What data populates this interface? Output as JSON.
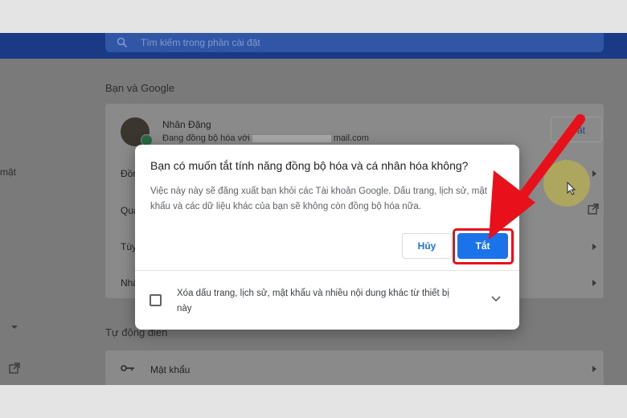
{
  "search": {
    "placeholder": "Tìm kiếm trong phần cài đặt",
    "icon": "search-icon"
  },
  "sidebar": {
    "partial_label": "mật"
  },
  "sections": {
    "you_and_google": {
      "title": "Bạn và Google",
      "user_name": "Nhân Đặng",
      "sync_status": "Đang đồng bộ hóa với",
      "email_suffix": "mail.com",
      "turn_off_label": "Tắt",
      "rows": [
        "Đồn",
        "Quả",
        "Tùy",
        "Nhậ"
      ]
    },
    "autofill": {
      "title": "Tự động điền",
      "password_label": "Mật khẩu"
    }
  },
  "dialog": {
    "title": "Bạn có muốn tắt tính năng đồng bộ hóa và cá nhân hóa không?",
    "body": "Việc này này sẽ đăng xuất bạn khỏi các Tài khoản Google. Dấu trang, lịch sử, mật khẩu và các dữ liệu khác của bạn sẽ không còn đồng bộ hóa nữa.",
    "cancel_label": "Hủy",
    "confirm_label": "Tắt",
    "checkbox_label": "Xóa dấu trang, lịch sử, mật khẩu và nhiều nội dung khác từ thiết bị này",
    "checkbox_checked": false
  },
  "colors": {
    "accent": "#1a73e8",
    "highlight": "#e8101a",
    "topbar": "#1a3a86"
  }
}
